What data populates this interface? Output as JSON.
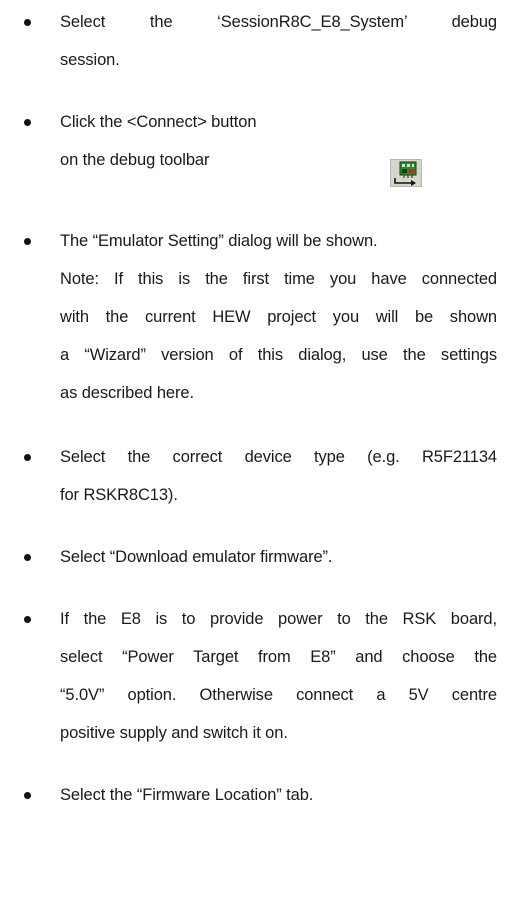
{
  "items": [
    {
      "lines": [
        "Select the ‘SessionR8C_E8_System’ debug",
        "session."
      ],
      "justify": [
        true,
        false
      ]
    },
    {
      "lines": [
        "Click the <Connect> button",
        "on the debug toolbar"
      ],
      "justify": [
        false,
        false
      ]
    },
    {
      "lines": [
        "The “Emulator Setting” dialog will be shown.",
        "Note: If this is the first time you have connected",
        "with the current HEW project you will be shown",
        "a “Wizard” version of this dialog, use the settings",
        "as described here."
      ],
      "justify": [
        false,
        true,
        true,
        true,
        false
      ]
    },
    {
      "lines": [
        "Select the correct device type (e.g. R5F21134",
        "for RSKR8C13)."
      ],
      "justify": [
        true,
        false
      ]
    },
    {
      "lines": [
        "Select “Download emulator firmware”."
      ],
      "justify": [
        false
      ]
    },
    {
      "lines": [
        "If the E8 is to provide power to the RSK board,",
        "select “Power Target from E8” and choose the",
        "“5.0V” option. Otherwise connect a 5V centre",
        "positive supply and switch it on."
      ],
      "justify": [
        true,
        true,
        true,
        false
      ]
    },
    {
      "lines": [
        "Select the “Firmware Location” tab."
      ],
      "justify": [
        false
      ]
    }
  ],
  "connect_icon": "connect-toolbar-icon"
}
